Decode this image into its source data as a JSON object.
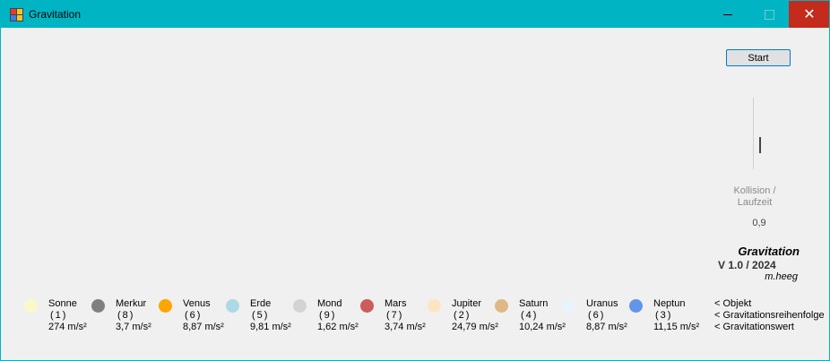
{
  "window": {
    "title": "Gravitation",
    "controls": {
      "minimize": "–",
      "close": "✕"
    }
  },
  "controls": {
    "start_label": "Start",
    "kollision_label_line1": "Kollision /",
    "kollision_label_line2": "Laufzeit",
    "kollision_value": "0,9"
  },
  "info": {
    "app_name": "Gravitation",
    "version": "V  1.0 / 2024",
    "author": "m.heeg"
  },
  "planets": [
    {
      "name": "Sonne",
      "order": "(1)",
      "gravity": "274 m/s²",
      "color": "#f9f9c8"
    },
    {
      "name": "Merkur",
      "order": "(8)",
      "gravity": "3,7 m/s²",
      "color": "#808080"
    },
    {
      "name": "Venus",
      "order": "(6)",
      "gravity": "8,87 m/s²",
      "color": "#ffa500"
    },
    {
      "name": "Erde",
      "order": "(5)",
      "gravity": "9,81 m/s²",
      "color": "#add8e6"
    },
    {
      "name": "Mond",
      "order": "(9)",
      "gravity": "1,62 m/s²",
      "color": "#d3d3d3"
    },
    {
      "name": "Mars",
      "order": "(7)",
      "gravity": "3,74 m/s²",
      "color": "#cd5c5c"
    },
    {
      "name": "Jupiter",
      "order": "(2)",
      "gravity": "24,79 m/s²",
      "color": "#ffe4c4"
    },
    {
      "name": "Saturn",
      "order": "(4)",
      "gravity": "10,24 m/s²",
      "color": "#deb887"
    },
    {
      "name": "Uranus",
      "order": "(6)",
      "gravity": "8,87 m/s²",
      "color": "#e8f4fb"
    },
    {
      "name": "Neptun",
      "order": "(3)",
      "gravity": "11,15 m/s²",
      "color": "#6495ed"
    }
  ],
  "legend": {
    "objekt": "<  Objekt",
    "reihenfolge": "<  Gravitationsreihenfolge",
    "wert": "<  Gravitationswert"
  }
}
